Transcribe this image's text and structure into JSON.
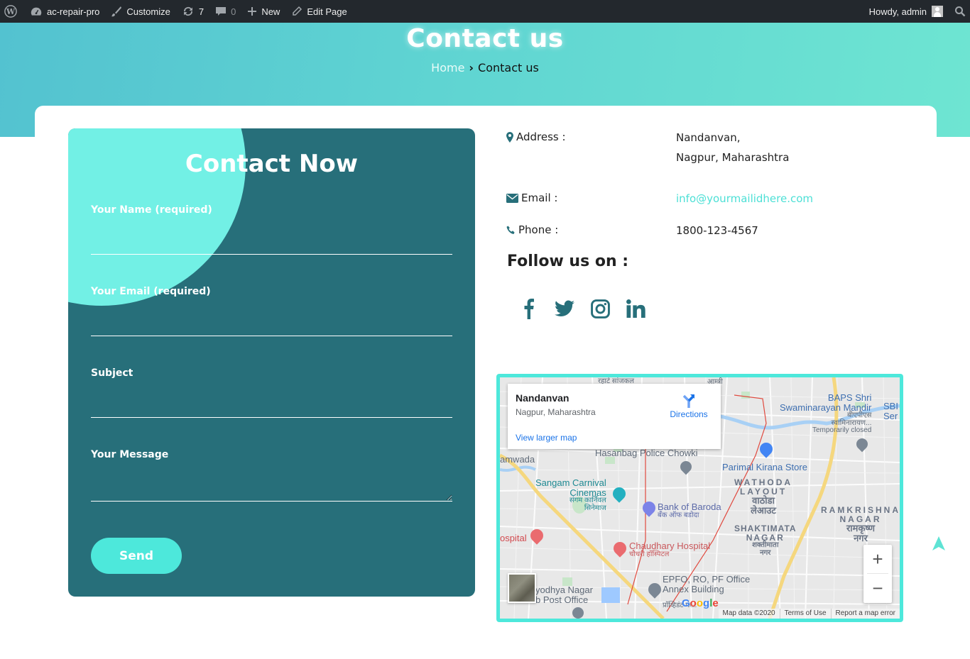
{
  "adminbar": {
    "site_name": "ac-repair-pro",
    "customize": "Customize",
    "updates_count": "7",
    "comments_count": "0",
    "new_label": "New",
    "edit_page": "Edit Page",
    "howdy": "Howdy, admin"
  },
  "hero": {
    "title": "Contact us",
    "breadcrumb": {
      "home": "Home",
      "current": "Contact us"
    }
  },
  "form": {
    "title": "Contact Now",
    "fields": [
      {
        "label": "Your Name (required)",
        "value": ""
      },
      {
        "label": "Your Email (required)",
        "value": ""
      },
      {
        "label": "Subject",
        "value": ""
      },
      {
        "label": "Your Message",
        "value": ""
      }
    ],
    "send_label": "Send"
  },
  "info": {
    "address_label": "Address :",
    "address_line1": "Nandanvan,",
    "address_line2": "Nagpur, Maharashtra",
    "email_label": "Email :",
    "email_value": "info@yourmailidhere.com",
    "phone_label": "Phone :",
    "phone_value": "1800-123-4567",
    "follow_title": "Follow us on :",
    "social": [
      "facebook",
      "twitter",
      "instagram",
      "linkedin"
    ]
  },
  "map": {
    "place_name": "Nandanvan",
    "place_address": "Nagpur, Maharashtra",
    "directions": "Directions",
    "view_larger": "View larger map",
    "zoom_in": "+",
    "zoom_out": "−",
    "footer": {
      "map_data": "Map data ©2020",
      "terms": "Terms of Use",
      "report": "Report a map error"
    },
    "labels": {
      "hasanbag": "Hasanbag Police Chowki",
      "mamwada": "amwada",
      "sangam": "Sangam Carnival",
      "cinemas": "Cinemas",
      "sangam_hi1": "संगम कार्निवल",
      "sangam_hi2": "सिनेमाज",
      "bank": "Bank of Baroda",
      "bank_hi": "बँक ऑफ बडोदा",
      "parimal": "Parimal Kirana Store",
      "wathoda1": "WATHODA",
      "wathoda2": "LAYOUT",
      "wathoda_hi1": "वाठोडा",
      "wathoda_hi2": "लेआउट",
      "baps1": "BAPS Shri",
      "baps2": "Swaminarayan Mandir",
      "baps_hi1": "बीएपीएस",
      "baps_hi2": "स्वामिनारायण...",
      "baps_status": "Temporarily closed",
      "sbi1": "SBI",
      "sbi2": "Ser",
      "ramkrishna1": "RAMKRISHNA",
      "ramkrishna2": "NAGAR",
      "ramkrishna_hi1": "रामकृष्ण",
      "ramkrishna_hi2": "नगर",
      "shaktimata1": "SHAKTIMATA",
      "shaktimata2": "NAGAR",
      "shaktimata_hi1": "शक्तीमाता",
      "shaktimata_hi2": "नगर",
      "hospital_left": "ospital",
      "chaudhary": "Chaudhary Hospital",
      "chaudhary_hi": "चौधरी हॉस्पिटल",
      "epfo1": "EPFO, RO, PF Office",
      "epfo2": "Annex Building",
      "epfo_hi": "प्रॉव्हिडंट फं...",
      "ayodhya1": "yodhya Nagar",
      "ayodhya2": "b Post Office",
      "rahate": "रहाटे सांजकल",
      "top_hi": "आम्त्री"
    }
  },
  "colors": {
    "accent": "#4de8db",
    "panel": "#276f7a",
    "circle": "#72f0e5",
    "link": "#4de0d6"
  }
}
